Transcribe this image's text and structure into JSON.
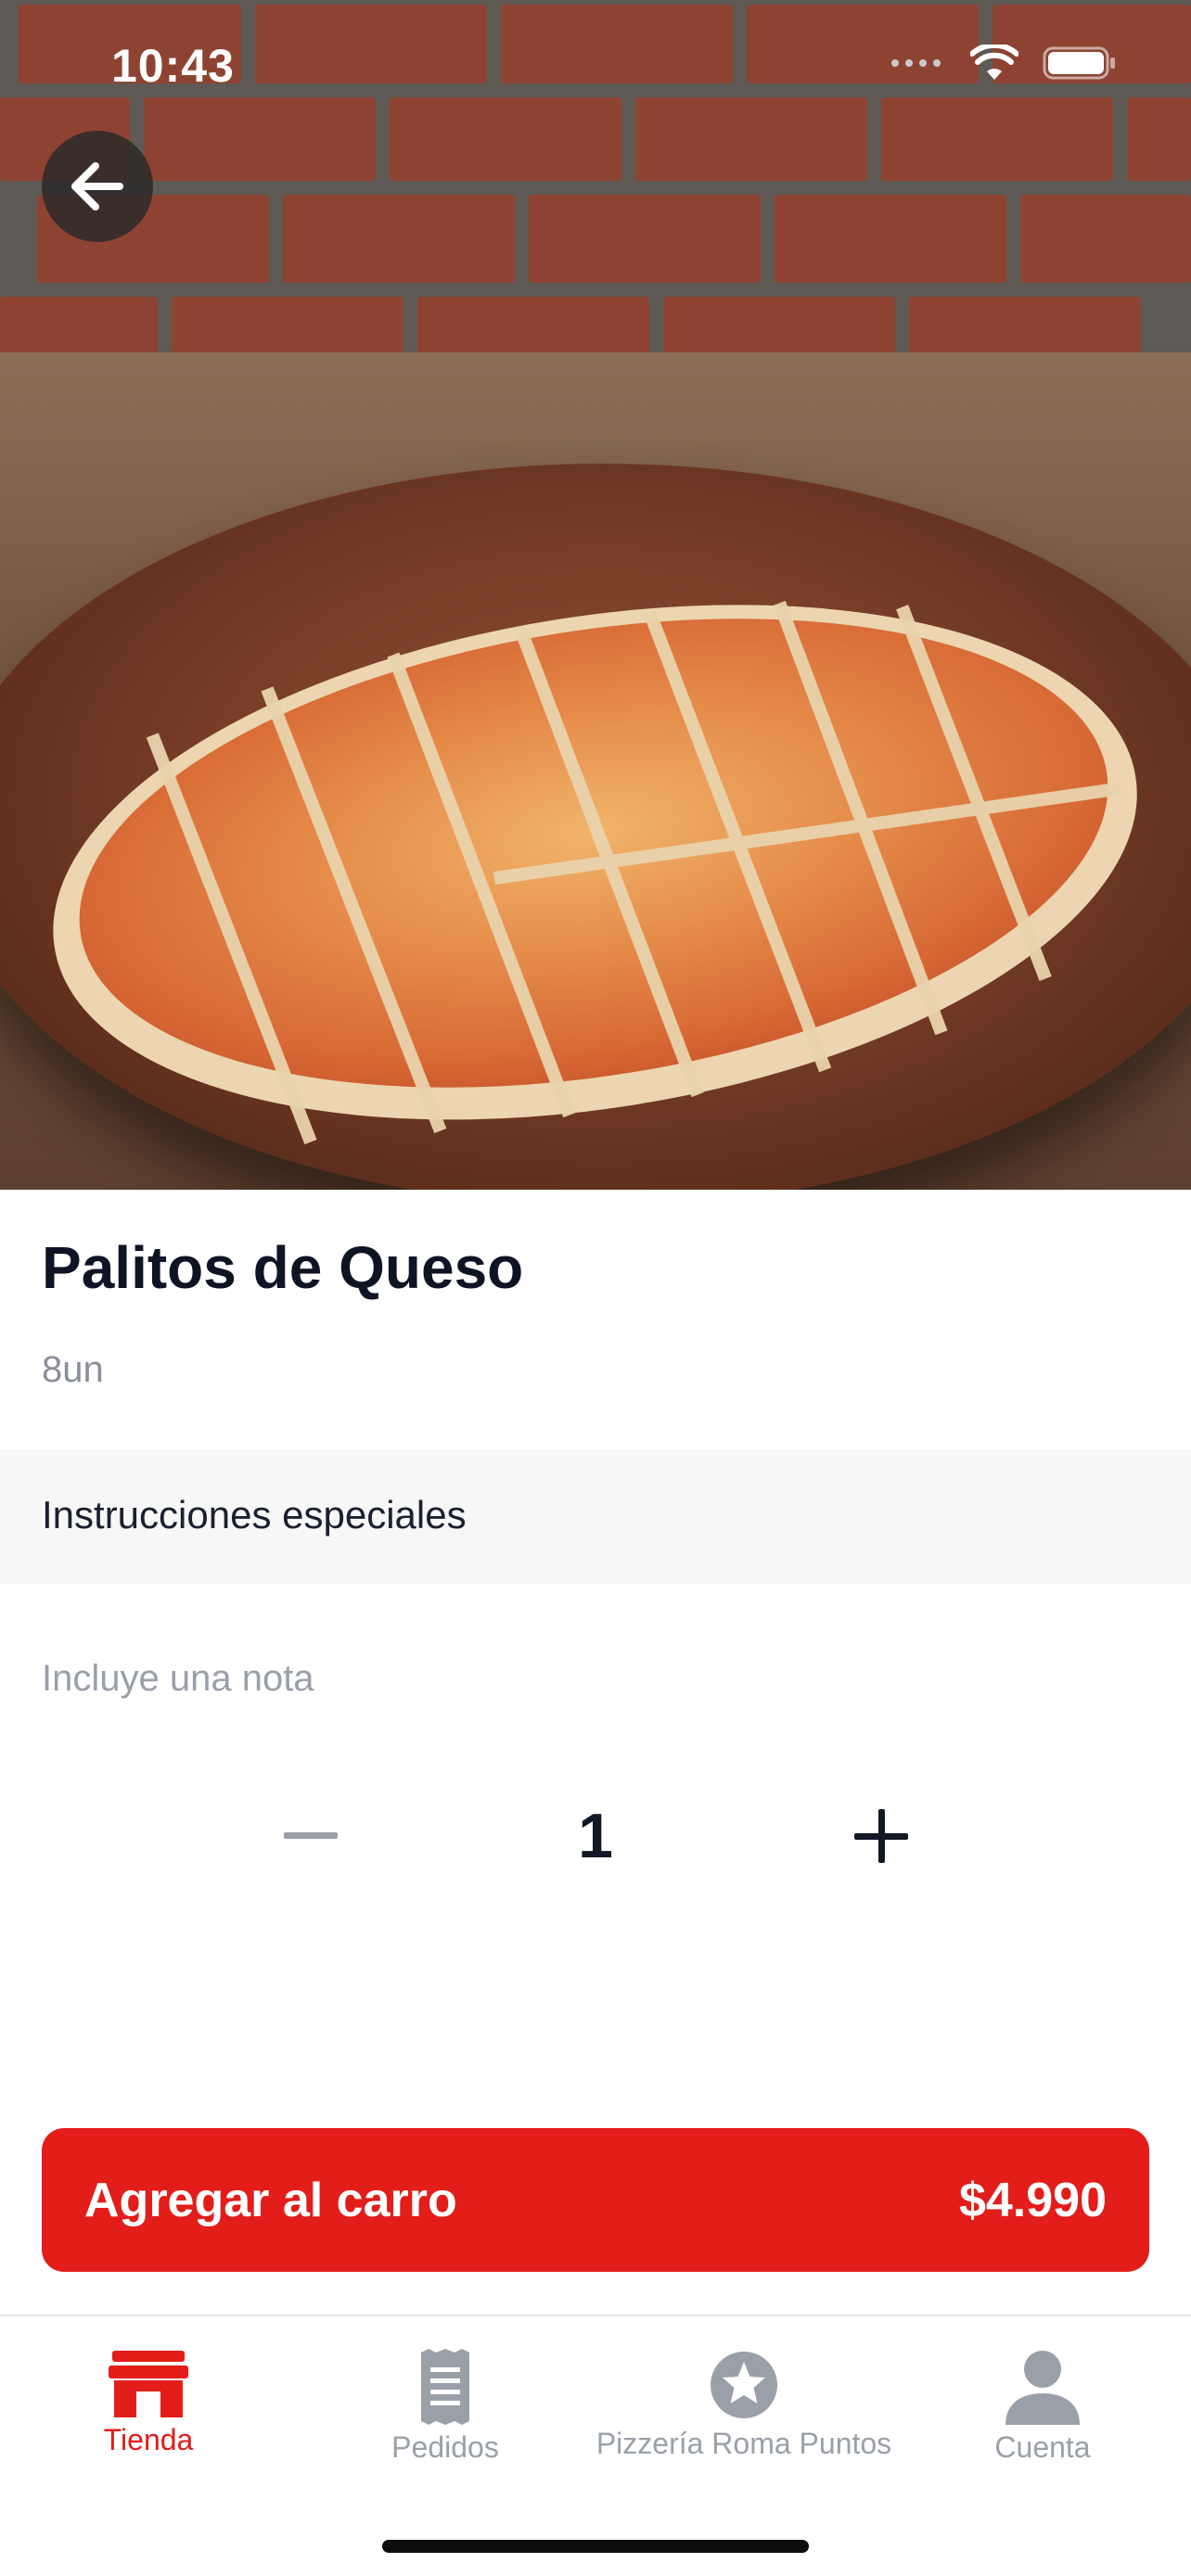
{
  "status_bar": {
    "time": "10:43"
  },
  "product": {
    "title": "Palitos de Queso",
    "subtitle": "8un"
  },
  "special_instructions": {
    "title": "Instrucciones especiales",
    "note_placeholder": "Incluye una nota"
  },
  "quantity": {
    "value": "1"
  },
  "cart_button": {
    "label": "Agregar al carro",
    "price": "$4.990"
  },
  "tab_bar": {
    "tabs": [
      {
        "label": "Tienda",
        "icon": "store-icon",
        "active": true
      },
      {
        "label": "Pedidos",
        "icon": "receipt-icon",
        "active": false
      },
      {
        "label": "Pizzería Roma Puntos",
        "icon": "star-badge-icon",
        "active": false
      },
      {
        "label": "Cuenta",
        "icon": "person-icon",
        "active": false
      }
    ]
  },
  "colors": {
    "accent": "#e21d1a",
    "tab_inactive": "#9aa0a8",
    "section_background": "#f7f7f8"
  }
}
